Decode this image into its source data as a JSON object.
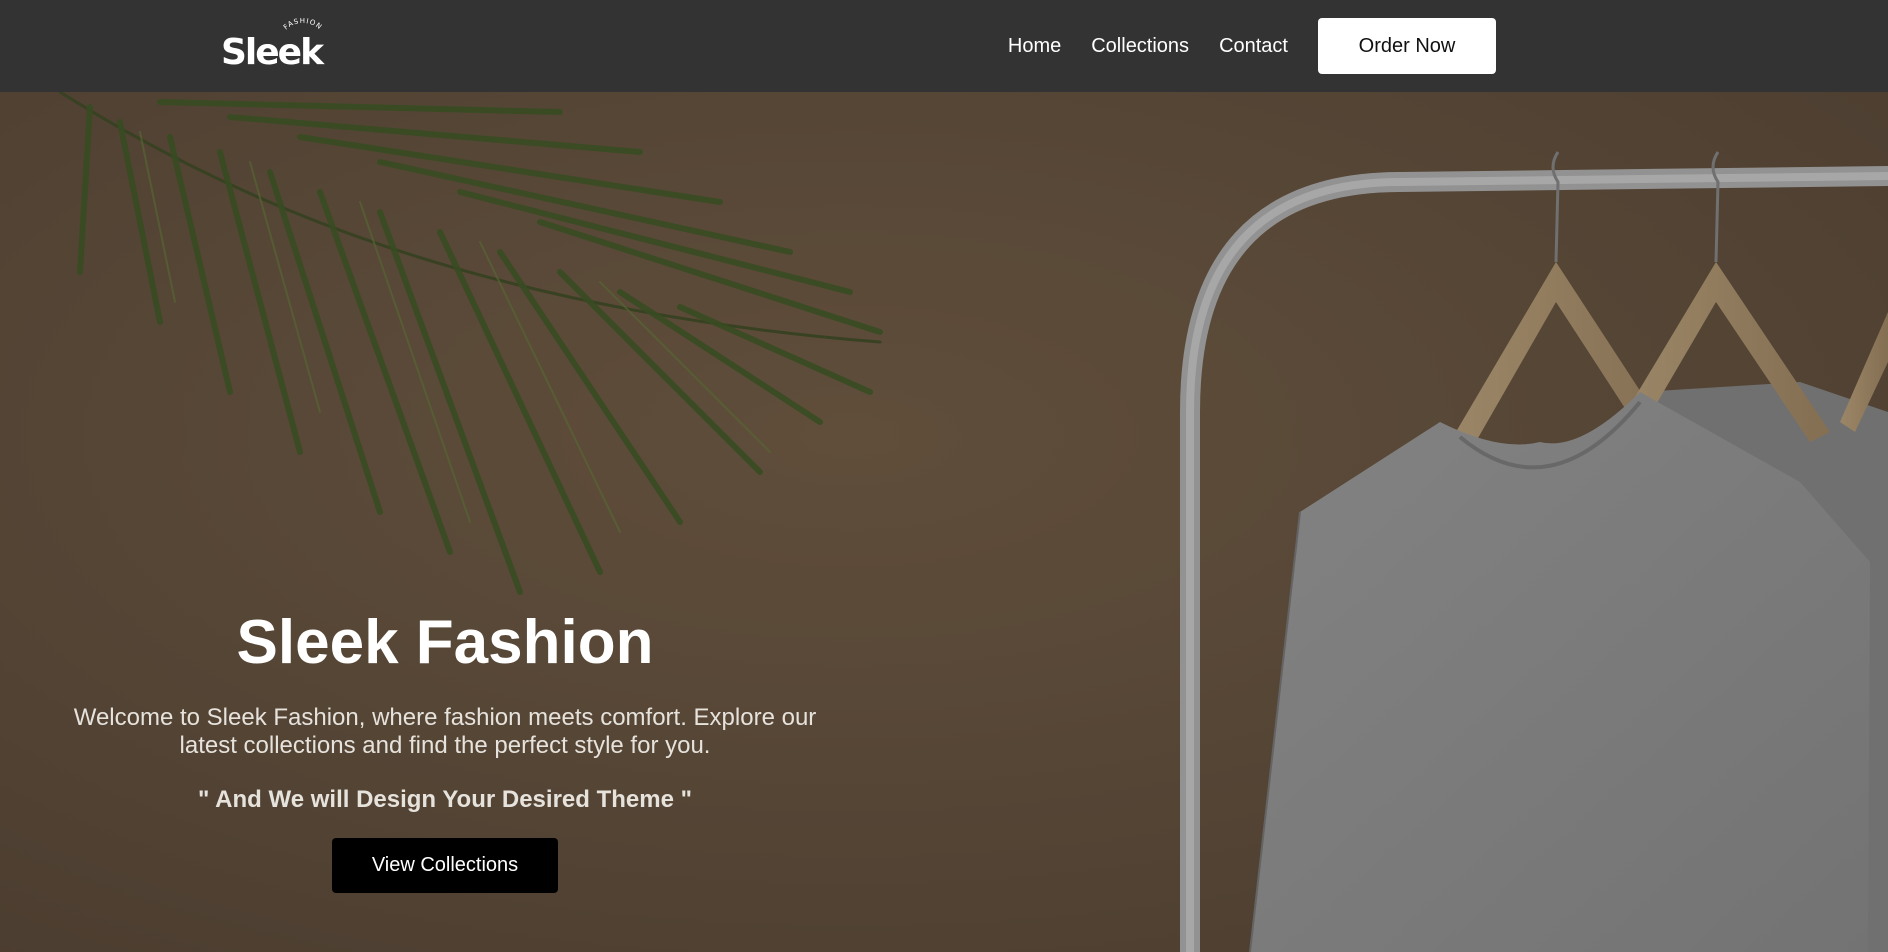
{
  "brand": {
    "logo_text": "Sleek",
    "logo_subtext": "FASHION"
  },
  "nav": {
    "links": [
      {
        "label": "Home"
      },
      {
        "label": "Collections"
      },
      {
        "label": "Contact"
      }
    ],
    "cta_label": "Order Now"
  },
  "hero": {
    "title": "Sleek Fashion",
    "description": "Welcome to Sleek Fashion, where fashion meets comfort. Explore our latest collections and find the perfect style for you.",
    "tagline": "\" And We will Design Your Desired Theme \"",
    "button_label": "View Collections"
  },
  "colors": {
    "navbar_bg": "#333333",
    "hero_bg": "#5c4b3a",
    "cta_bg": "#ffffff",
    "hero_button_bg": "#000000",
    "text_light": "#ffffff"
  }
}
